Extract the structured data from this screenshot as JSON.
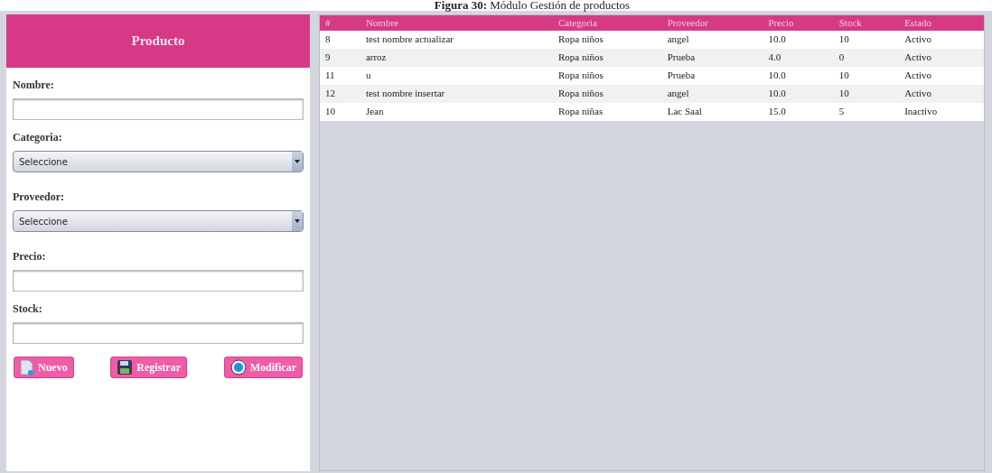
{
  "caption": "**Figura 30:** Módulo Gestión de productos",
  "form": {
    "title": "Producto",
    "fields": [
      {
        "kind": "input",
        "label": "Nombre:"
      },
      {
        "kind": "select",
        "label": "Categoria:",
        "value": "Seleccione"
      },
      {
        "kind": "select",
        "label": "Proveedor:",
        "value": "Seleccione"
      },
      {
        "kind": "input",
        "label": "Precio:"
      },
      {
        "kind": "input",
        "label": "Stock:"
      }
    ],
    "buttons": [
      {
        "kind": "new",
        "label": "Nuevo"
      },
      {
        "kind": "save",
        "label": "Registrar"
      },
      {
        "kind": "edit",
        "label": "Modificar"
      }
    ]
  },
  "table": {
    "columns": [
      "#",
      "Nombre",
      "Categoria",
      "Proveedor",
      "Precio",
      "Stock",
      "Estado"
    ],
    "rows": [
      [
        "8",
        "test nombre actualizar",
        "Ropa niños",
        "angel",
        "10.0",
        "10",
        "Activo"
      ],
      [
        "9",
        "arroz",
        "Ropa niños",
        "Prueba",
        "4.0",
        "0",
        "Activo"
      ],
      [
        "11",
        "u",
        "Ropa niños",
        "Prueba",
        "10.0",
        "10",
        "Activo"
      ],
      [
        "12",
        "test nombre insertar",
        "Ropa niños",
        "angel",
        "10.0",
        "10",
        "Activo"
      ],
      [
        "10",
        "Jean",
        "Ropa niñas",
        "Lac Saal",
        "15.0",
        "5",
        "Inactivo"
      ]
    ]
  }
}
